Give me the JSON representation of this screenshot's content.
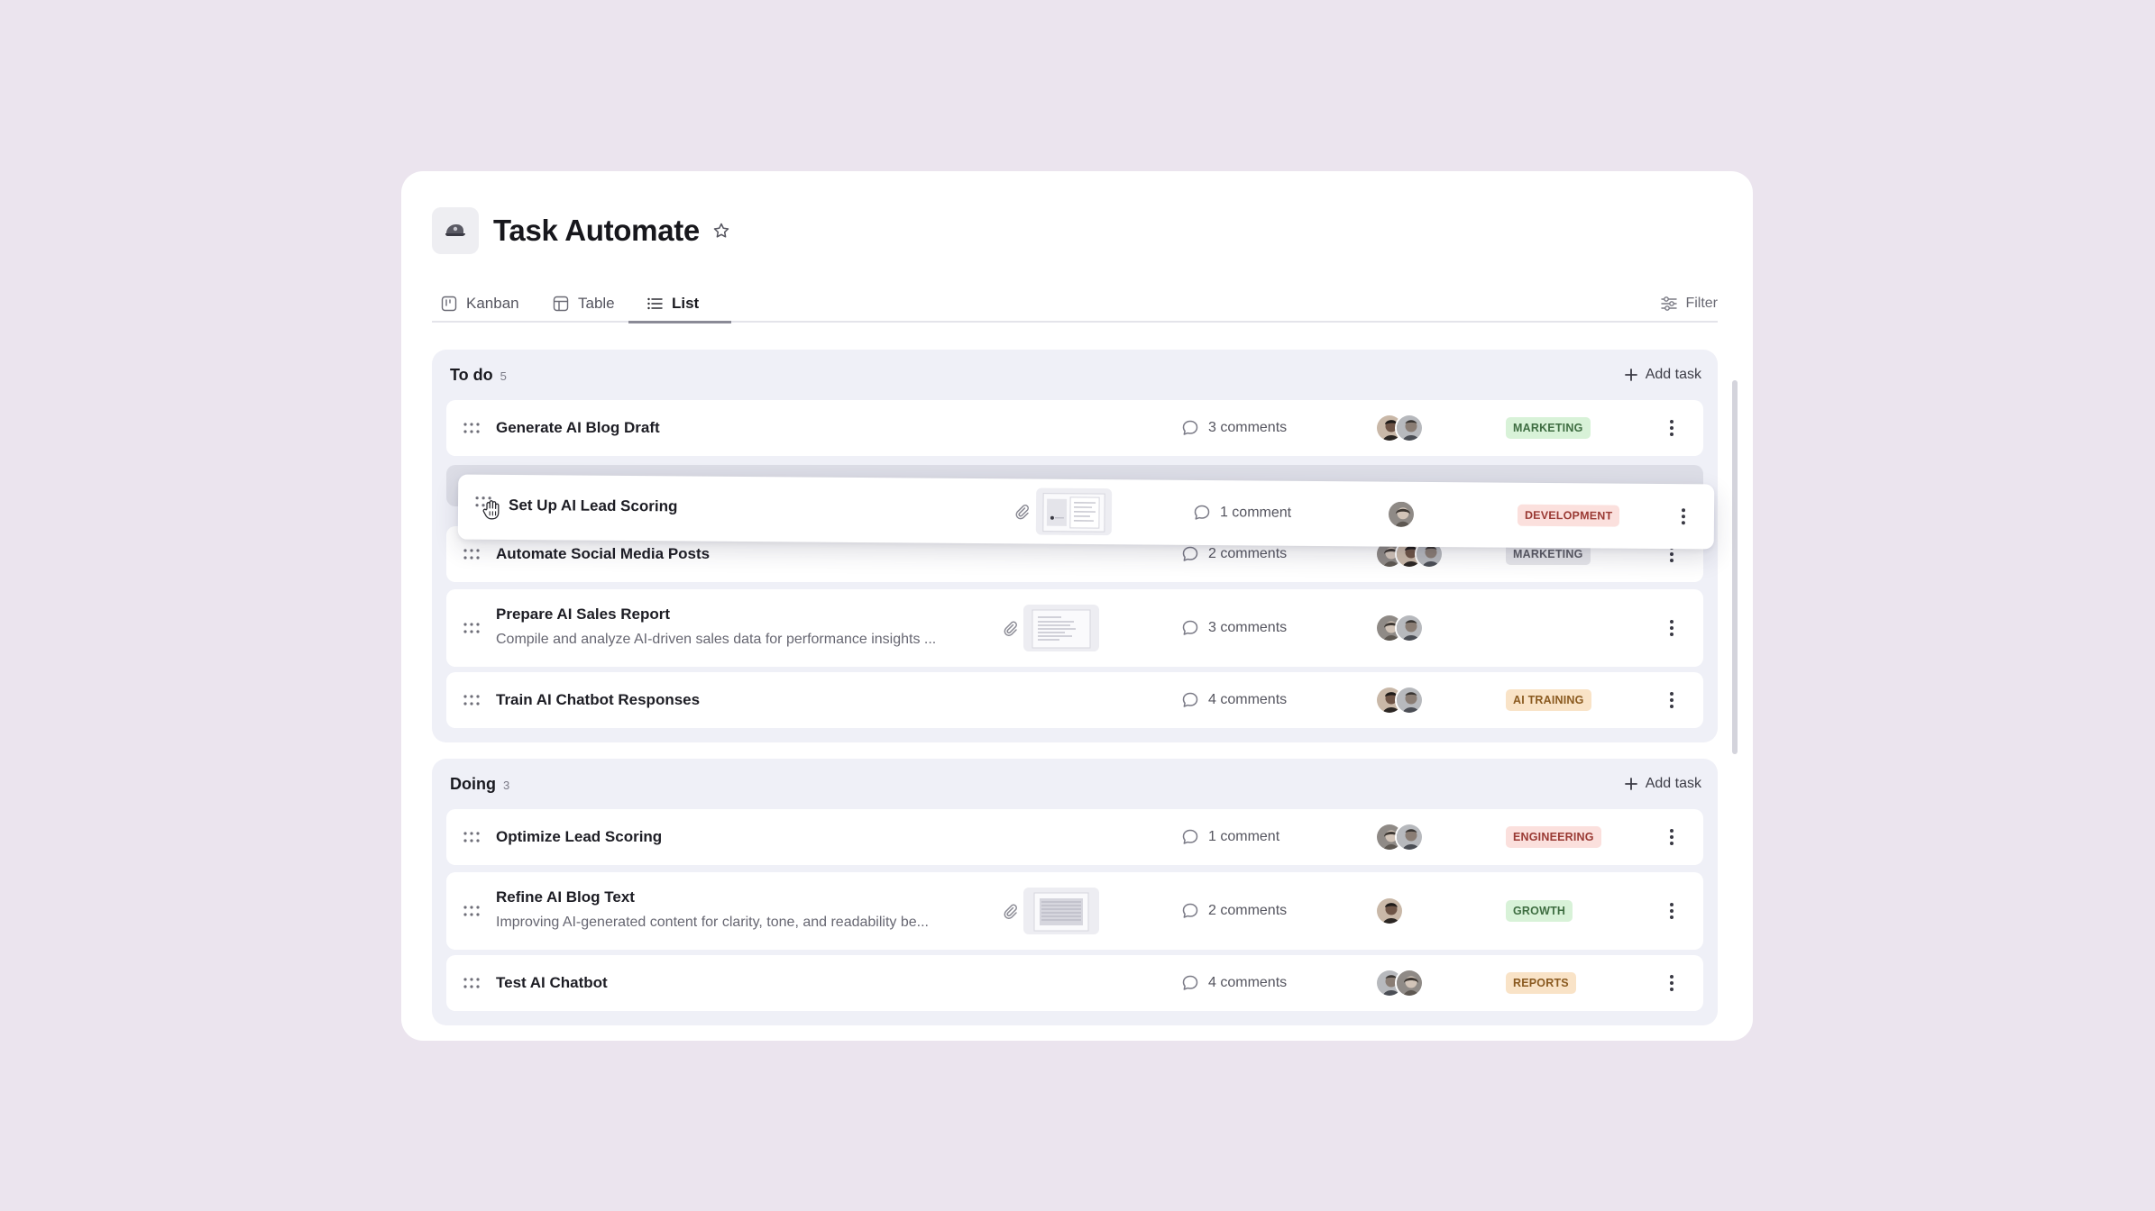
{
  "app": {
    "title": "Task Automate",
    "logo_icon": "cap-icon",
    "star_icon": "star-icon"
  },
  "views": {
    "tabs": [
      {
        "label": "Kanban",
        "icon": "kanban-icon",
        "active": false
      },
      {
        "label": "Table",
        "icon": "table-icon",
        "active": false
      },
      {
        "label": "List",
        "icon": "list-icon",
        "active": true
      }
    ],
    "filter_label": "Filter"
  },
  "groups": [
    {
      "title": "To do",
      "count": "5",
      "add_label": "Add task",
      "tasks": [
        {
          "title": "Generate AI Blog Draft",
          "comments": "3 comments",
          "tag": "MARKETING"
        },
        {
          "title": "Automate Social Media Posts",
          "comments": "2 comments",
          "tag": "MARKETING"
        },
        {
          "title": "Prepare AI Sales Report",
          "description": "Compile and analyze AI-driven sales data for performance insights ...",
          "comments": "3 comments",
          "tag": ""
        },
        {
          "title": "Train AI Chatbot Responses",
          "comments": "4 comments",
          "tag": "AI TRAINING"
        }
      ]
    },
    {
      "title": "Doing",
      "count": "3",
      "add_label": "Add task",
      "tasks": [
        {
          "title": "Optimize Lead Scoring",
          "comments": "1 comment",
          "tag": "ENGINEERING"
        },
        {
          "title": "Refine AI Blog Text",
          "description": "Improving AI-generated content for clarity, tone, and readability be...",
          "comments": "2 comments",
          "tag": "GROWTH"
        },
        {
          "title": "Test AI Chatbot",
          "comments": "4 comments",
          "tag": "REPORTS"
        }
      ]
    }
  ],
  "dragging_task": {
    "title": "Set Up AI Lead Scoring",
    "comments": "1 comment",
    "tag": "DEVELOPMENT"
  },
  "colors": {
    "background": "#ebe4ee",
    "group_background": "#eff0f7",
    "tag_green": "#d8f2d8",
    "tag_grey": "#e6e6ea",
    "tag_orange": "#f9e3c7",
    "tag_red": "#fbe0dd"
  }
}
